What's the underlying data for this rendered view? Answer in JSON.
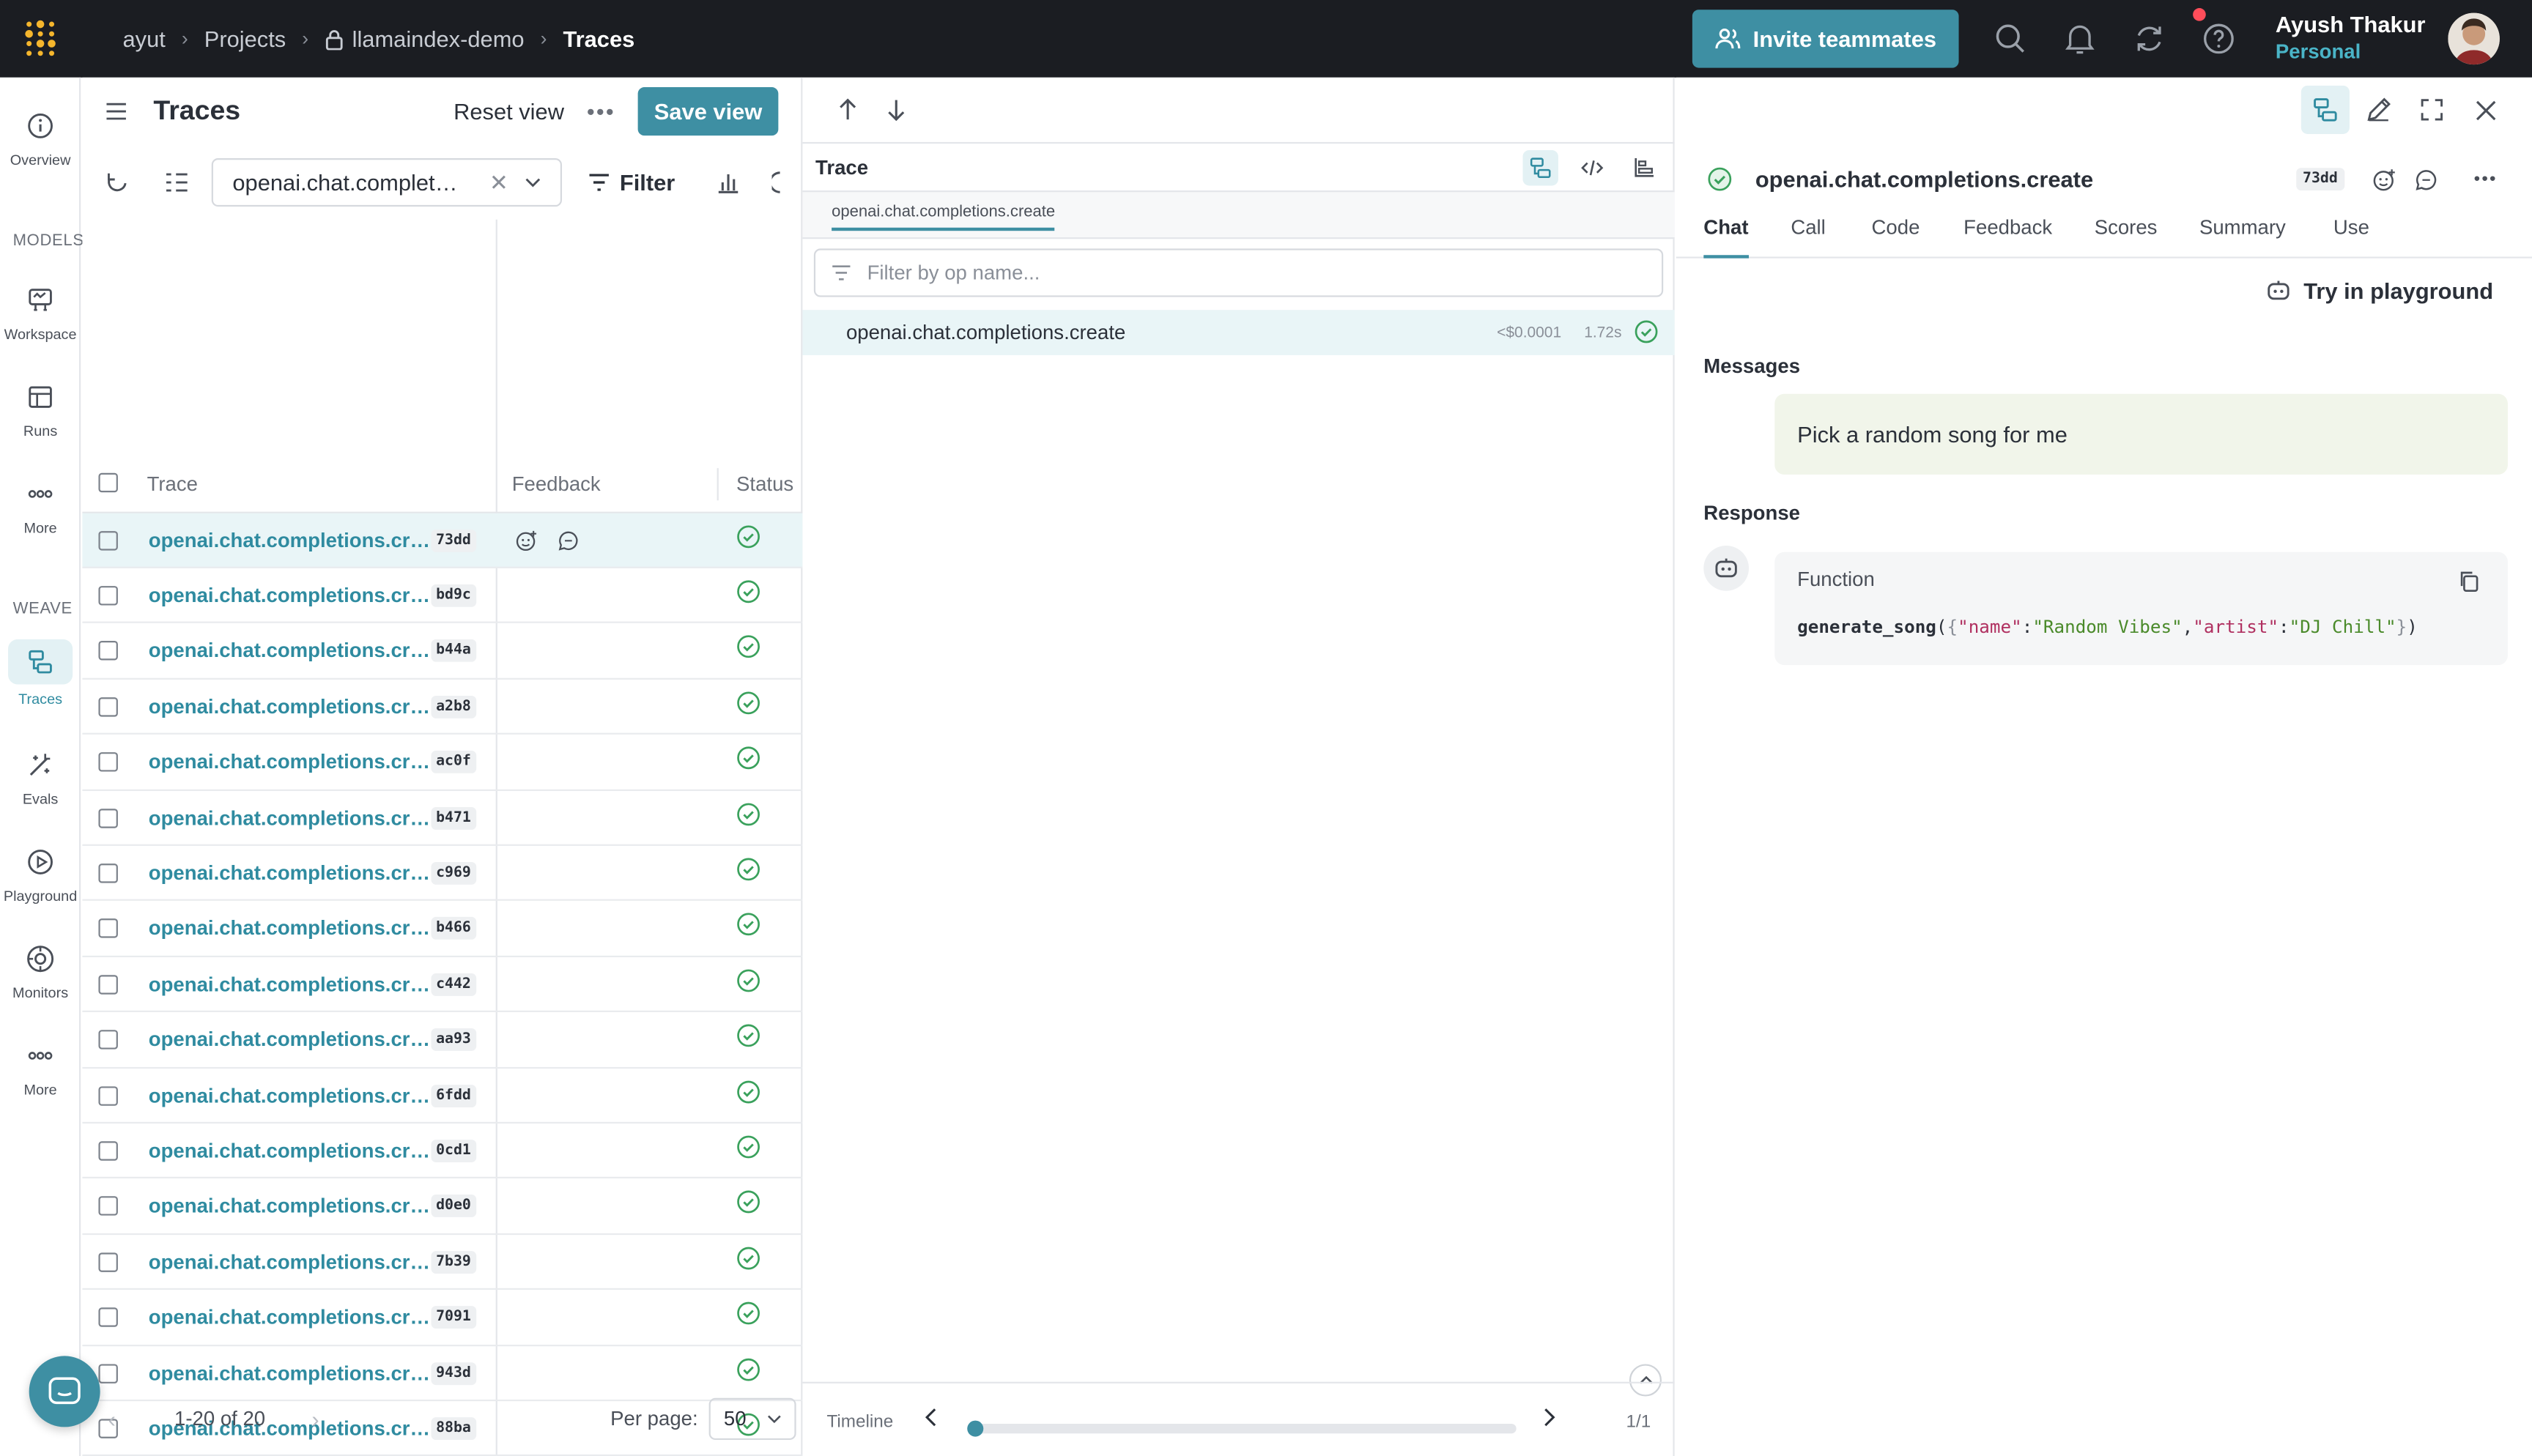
{
  "topbar": {
    "breadcrumbs": [
      "ayut",
      "Projects",
      "llamaindex-demo",
      "Traces"
    ],
    "invite_label": "Invite teammates",
    "user_name": "Ayush Thakur",
    "user_plan": "Personal"
  },
  "rail": {
    "overview": "Overview",
    "models_section": "MODELS",
    "workspace": "Workspace",
    "runs": "Runs",
    "more1": "More",
    "weave_section": "WEAVE",
    "traces": "Traces",
    "evals": "Evals",
    "playground": "Playground",
    "monitors": "Monitors",
    "more2": "More"
  },
  "list": {
    "title": "Traces",
    "reset_view": "Reset view",
    "save_view": "Save view",
    "filter_value": "openai.chat.complet…",
    "filter_label": "Filter",
    "columns": {
      "trace": "Trace",
      "feedback": "Feedback",
      "status": "Status"
    },
    "rows": [
      {
        "name": "openai.chat.completions.cr…",
        "hash": "73dd"
      },
      {
        "name": "openai.chat.completions.cr…",
        "hash": "bd9c"
      },
      {
        "name": "openai.chat.completions.cr…",
        "hash": "b44a"
      },
      {
        "name": "openai.chat.completions.cr…",
        "hash": "a2b8"
      },
      {
        "name": "openai.chat.completions.cr…",
        "hash": "ac0f"
      },
      {
        "name": "openai.chat.completions.cr…",
        "hash": "b471"
      },
      {
        "name": "openai.chat.completions.cr…",
        "hash": "c969"
      },
      {
        "name": "openai.chat.completions.cr…",
        "hash": "b466"
      },
      {
        "name": "openai.chat.completions.cr…",
        "hash": "c442"
      },
      {
        "name": "openai.chat.completions.cr…",
        "hash": "aa93"
      },
      {
        "name": "openai.chat.completions.cr…",
        "hash": "6fdd"
      },
      {
        "name": "openai.chat.completions.cr…",
        "hash": "0cd1"
      },
      {
        "name": "openai.chat.completions.cr…",
        "hash": "d0e0"
      },
      {
        "name": "openai.chat.completions.cr…",
        "hash": "7b39"
      },
      {
        "name": "openai.chat.completions.cr…",
        "hash": "7091"
      },
      {
        "name": "openai.chat.completions.cr…",
        "hash": "943d"
      },
      {
        "name": "openai.chat.completions.cr…",
        "hash": "88ba"
      }
    ],
    "pagination": "1-20 of 20",
    "per_page_label": "Per page:",
    "per_page_value": "50"
  },
  "trace": {
    "label": "Trace",
    "tab": "openai.chat.completions.create",
    "filter_placeholder": "Filter by op name...",
    "row_name": "openai.chat.completions.create",
    "row_cost": "<$0.0001",
    "row_latency": "1.72s",
    "timeline_label": "Timeline",
    "timeline_pages": "1/1",
    "timeline_position": 0
  },
  "detail": {
    "title": "openai.chat.completions.create",
    "hash": "73dd",
    "tabs": [
      "Chat",
      "Call",
      "Code",
      "Feedback",
      "Scores",
      "Summary",
      "Use"
    ],
    "try_playground": "Try in playground",
    "messages_label": "Messages",
    "user_message": "Pick a random song for me",
    "response_label": "Response",
    "function_label": "Function",
    "function_call": {
      "name": "generate_song",
      "key1": "\"name\"",
      "val1": "\"Random Vibes\"",
      "key2": "\"artist\"",
      "val2": "\"DJ Chill\""
    }
  },
  "colors": {
    "accent": "#3e8fa3",
    "topbar_bg": "#1b1d22",
    "selected_row": "#e9f5f7",
    "status_ok": "#3aa15c"
  }
}
